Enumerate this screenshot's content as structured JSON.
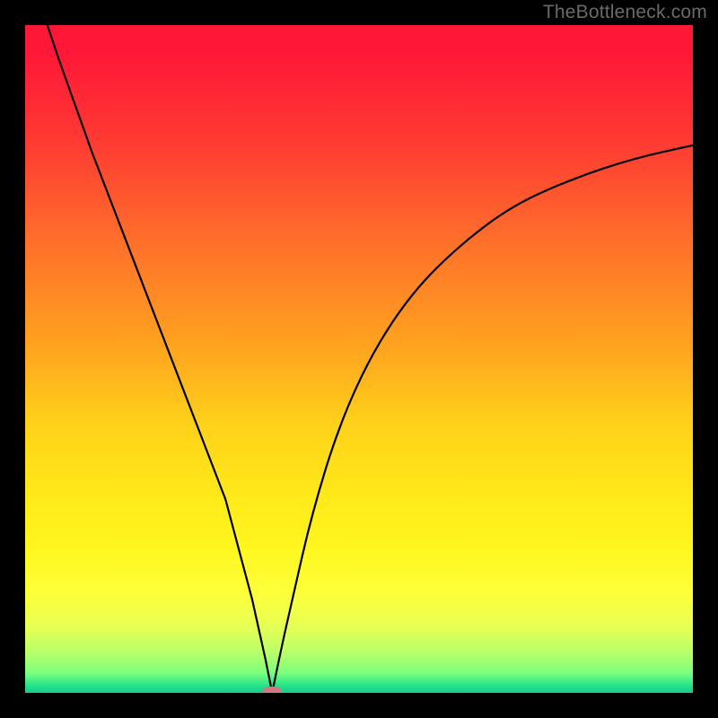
{
  "watermark": "TheBottleneck.com",
  "chart_data": {
    "type": "line",
    "title": "",
    "xlabel": "",
    "ylabel": "",
    "xlim": [
      0,
      100
    ],
    "ylim": [
      0,
      100
    ],
    "grid": false,
    "legend": false,
    "notch_x": 37,
    "series": [
      {
        "name": "bottleneck-curve",
        "x": [
          0,
          5,
          10,
          15,
          20,
          25,
          30,
          34,
          36,
          37,
          38,
          40,
          43,
          47,
          52,
          58,
          65,
          73,
          82,
          91,
          100
        ],
        "values": [
          110,
          95,
          81,
          68,
          55,
          42,
          29,
          14,
          5,
          0,
          5,
          14,
          27,
          40,
          51,
          60,
          67,
          73,
          77,
          80,
          82
        ]
      }
    ],
    "marker": {
      "x": 37,
      "y": 0,
      "color": "#cf7a80"
    },
    "background_gradient": {
      "top": "#ff1738",
      "mid": "#ffe81a",
      "bottom": "#19c98a"
    }
  }
}
